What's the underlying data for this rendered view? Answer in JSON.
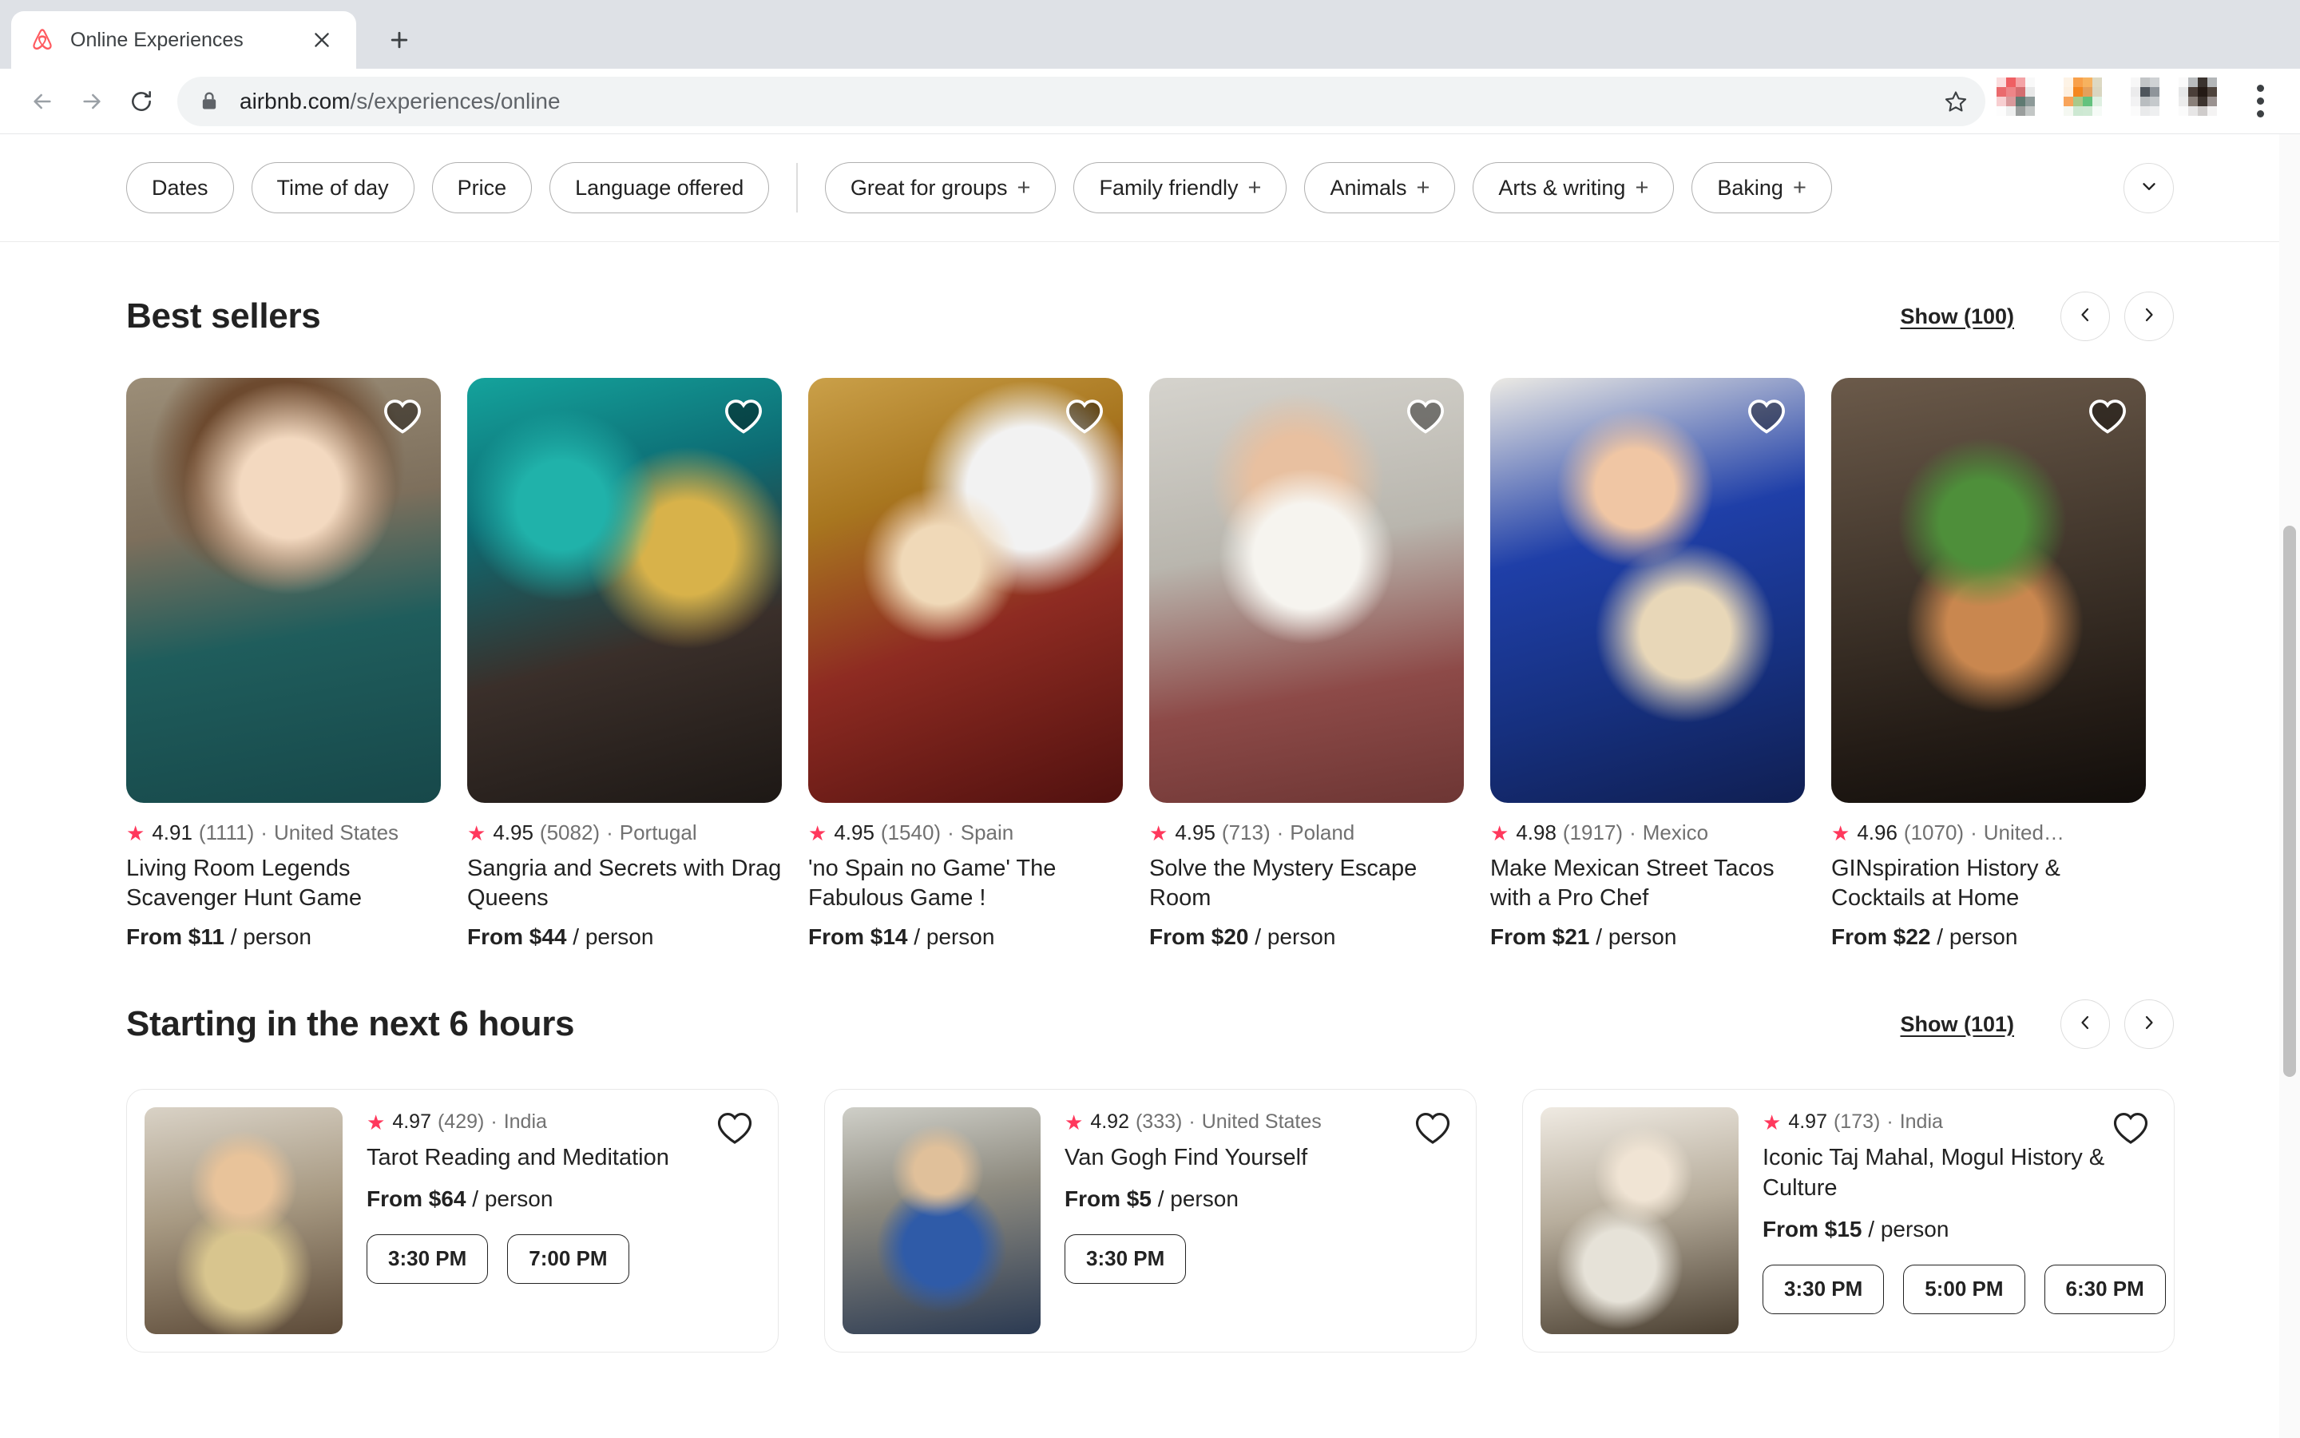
{
  "browser": {
    "tab_title": "Online Experiences",
    "favicon": "airbnb-logo-icon",
    "close_icon": "close-icon",
    "newtab_icon": "plus-icon",
    "back_icon": "back-arrow-icon",
    "forward_icon": "forward-arrow-icon",
    "reload_icon": "reload-icon",
    "lock_icon": "lock-icon",
    "url_domain": "airbnb.com",
    "url_path": "/s/experiences/online",
    "bookmark_icon": "star-icon",
    "menu_icon": "three-dots-icon",
    "extension_count": 4
  },
  "filters": {
    "primary": [
      {
        "label": "Dates"
      },
      {
        "label": "Time of day"
      },
      {
        "label": "Price"
      },
      {
        "label": "Language offered"
      }
    ],
    "categories": [
      {
        "label": "Great for groups",
        "plus": "+"
      },
      {
        "label": "Family friendly",
        "plus": "+"
      },
      {
        "label": "Animals",
        "plus": "+"
      },
      {
        "label": "Arts & writing",
        "plus": "+"
      },
      {
        "label": "Baking",
        "plus": "+"
      }
    ],
    "expand_icon": "chevron-down-icon"
  },
  "accent_color": "#ff385c",
  "sections": [
    {
      "title": "Best sellers",
      "show_label": "Show (100)",
      "prev_icon": "chevron-left-icon",
      "next_icon": "chevron-right-icon",
      "cards": [
        {
          "star": "★",
          "rating": "4.91",
          "reviews": "(1111)",
          "sep": "·",
          "location": "United States",
          "title": "Living Room Legends Scavenger Hunt Game",
          "price_from": "From $11",
          "price_unit": "/ person",
          "heart_icon": "heart-icon",
          "photo": "ph1"
        },
        {
          "star": "★",
          "rating": "4.95",
          "reviews": "(5082)",
          "sep": "·",
          "location": "Portugal",
          "title": "Sangria and Secrets with Drag Queens",
          "price_from": "From $44",
          "price_unit": "/ person",
          "heart_icon": "heart-icon",
          "photo": "ph2"
        },
        {
          "star": "★",
          "rating": "4.95",
          "reviews": "(1540)",
          "sep": "·",
          "location": "Spain",
          "title": "'no Spain no Game' The Fabulous Game !",
          "price_from": "From $14",
          "price_unit": "/ person",
          "heart_icon": "heart-icon",
          "photo": "ph3"
        },
        {
          "star": "★",
          "rating": "4.95",
          "reviews": "(713)",
          "sep": "·",
          "location": "Poland",
          "title": "Solve the Mystery Escape Room",
          "price_from": "From $20",
          "price_unit": "/ person",
          "heart_icon": "heart-icon",
          "photo": "ph4"
        },
        {
          "star": "★",
          "rating": "4.98",
          "reviews": "(1917)",
          "sep": "·",
          "location": "Mexico",
          "title": "Make Mexican Street Tacos with a Pro Chef",
          "price_from": "From $21",
          "price_unit": "/ person",
          "heart_icon": "heart-icon",
          "photo": "ph5"
        },
        {
          "star": "★",
          "rating": "4.96",
          "reviews": "(1070)",
          "sep": "·",
          "location": "United…",
          "title": "GINspiration History & Cocktails at Home",
          "price_from": "From $22",
          "price_unit": "/ person",
          "heart_icon": "heart-icon",
          "photo": "ph6"
        }
      ]
    },
    {
      "title": "Starting in the next 6 hours",
      "show_label": "Show (101)",
      "prev_icon": "chevron-left-icon",
      "next_icon": "chevron-right-icon",
      "cards": [
        {
          "star": "★",
          "rating": "4.97",
          "reviews": "(429)",
          "sep": "·",
          "location": "India",
          "title": "Tarot Reading and Meditation",
          "price_from": "From $64",
          "price_unit": "/ person",
          "times": [
            "3:30 PM",
            "7:00 PM"
          ],
          "heart_icon": "heart-icon",
          "photo": "ph7"
        },
        {
          "star": "★",
          "rating": "4.92",
          "reviews": "(333)",
          "sep": "·",
          "location": "United States",
          "title": "Van Gogh Find Yourself",
          "price_from": "From $5",
          "price_unit": "/ person",
          "times": [
            "3:30 PM"
          ],
          "heart_icon": "heart-icon",
          "photo": "ph8"
        },
        {
          "star": "★",
          "rating": "4.97",
          "reviews": "(173)",
          "sep": "·",
          "location": "India",
          "title": "Iconic Taj Mahal, Mogul History & Culture",
          "price_from": "From $15",
          "price_unit": "/ person",
          "times": [
            "3:30 PM",
            "5:00 PM",
            "6:30 PM"
          ],
          "heart_icon": "heart-icon",
          "photo": "ph9"
        }
      ]
    }
  ]
}
